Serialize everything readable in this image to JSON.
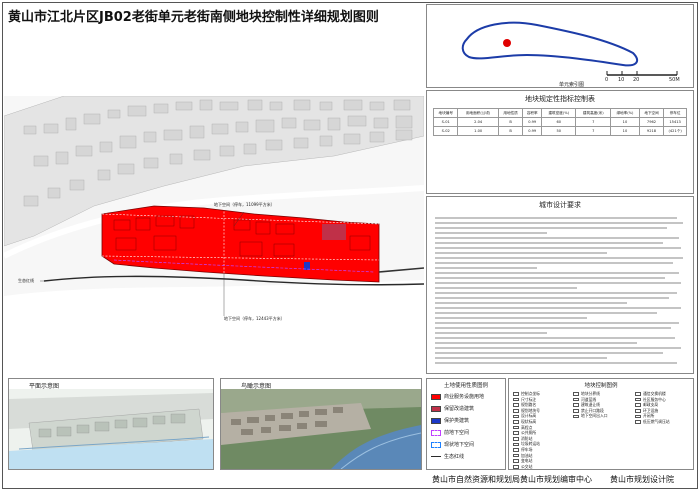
{
  "title": "黄山市江北片区JB02老街单元老街南侧地块控制性详细规划图则",
  "key_map": {
    "caption": "单元索引图",
    "scale_labels": [
      "0",
      "10",
      "20",
      "50M"
    ]
  },
  "main_map": {
    "labels": {
      "underground_space_1": "地下空间（停车，11099平方米）",
      "underground_space_2": "地下空间（停车，12443平方米）",
      "eco_line": "生态红线"
    }
  },
  "indicator_table": {
    "title": "地块规定性指标控制表",
    "headers": [
      "地块编号",
      "用地面积(公顷)",
      "用地性质",
      "容积率",
      "建筑密度(%)",
      "建筑高度(米)",
      "绿地率(%)",
      "地下空间",
      "停车位"
    ],
    "rows": [
      [
        "S-01",
        "2.04",
        "B",
        "0.99",
        "60",
        "7",
        "10",
        "7962",
        "15413"
      ],
      [
        "S-02",
        "1.00",
        "B",
        "0.99",
        "50",
        "7",
        "10",
        "9218",
        "(421个)"
      ]
    ]
  },
  "design_req": {
    "title": "城市设计要求"
  },
  "plan_view": {
    "title": "平面示意图"
  },
  "aerial_view": {
    "title": "鸟瞰示意图"
  },
  "land_legend": {
    "title": "土地使用性质图例",
    "items": [
      {
        "label": "商业服务设施用地",
        "color": "#ff0000"
      },
      {
        "label": "保留改造建筑",
        "color": "#c03048"
      },
      {
        "label": "保护类建筑",
        "color": "#1c38c8"
      },
      {
        "label": "前地下空间",
        "color": "#ffffff"
      },
      {
        "label": "现状地下空间",
        "color": "#ffffff"
      },
      {
        "label": "生态红线",
        "color": "#ffffff"
      }
    ]
  },
  "symbol_legend": {
    "title": "地块控制图例",
    "col1": [
      "控制点坐标",
      "尺寸标注",
      "规划路名",
      "规划地块号",
      "设计标高",
      "现状标高",
      "高程点",
      "公共厕所",
      "消防站",
      "垃圾转运站",
      "停车场",
      "加油站",
      "变电站",
      "公交站"
    ],
    "col2": [
      "地块分界线",
      "河道蓝线",
      "建筑退让线",
      "禁止开口路段",
      "地下空间出入口"
    ],
    "col3": [
      "通信交换机楼",
      "社区服务中心",
      "邮政支局",
      "环卫设施",
      "开闭所",
      "低压燃气调压站"
    ]
  },
  "footer": {
    "orgs": [
      "黄山市自然资源和规划局",
      "黄山市规划编审中心",
      "黄山市规划设计院"
    ]
  }
}
